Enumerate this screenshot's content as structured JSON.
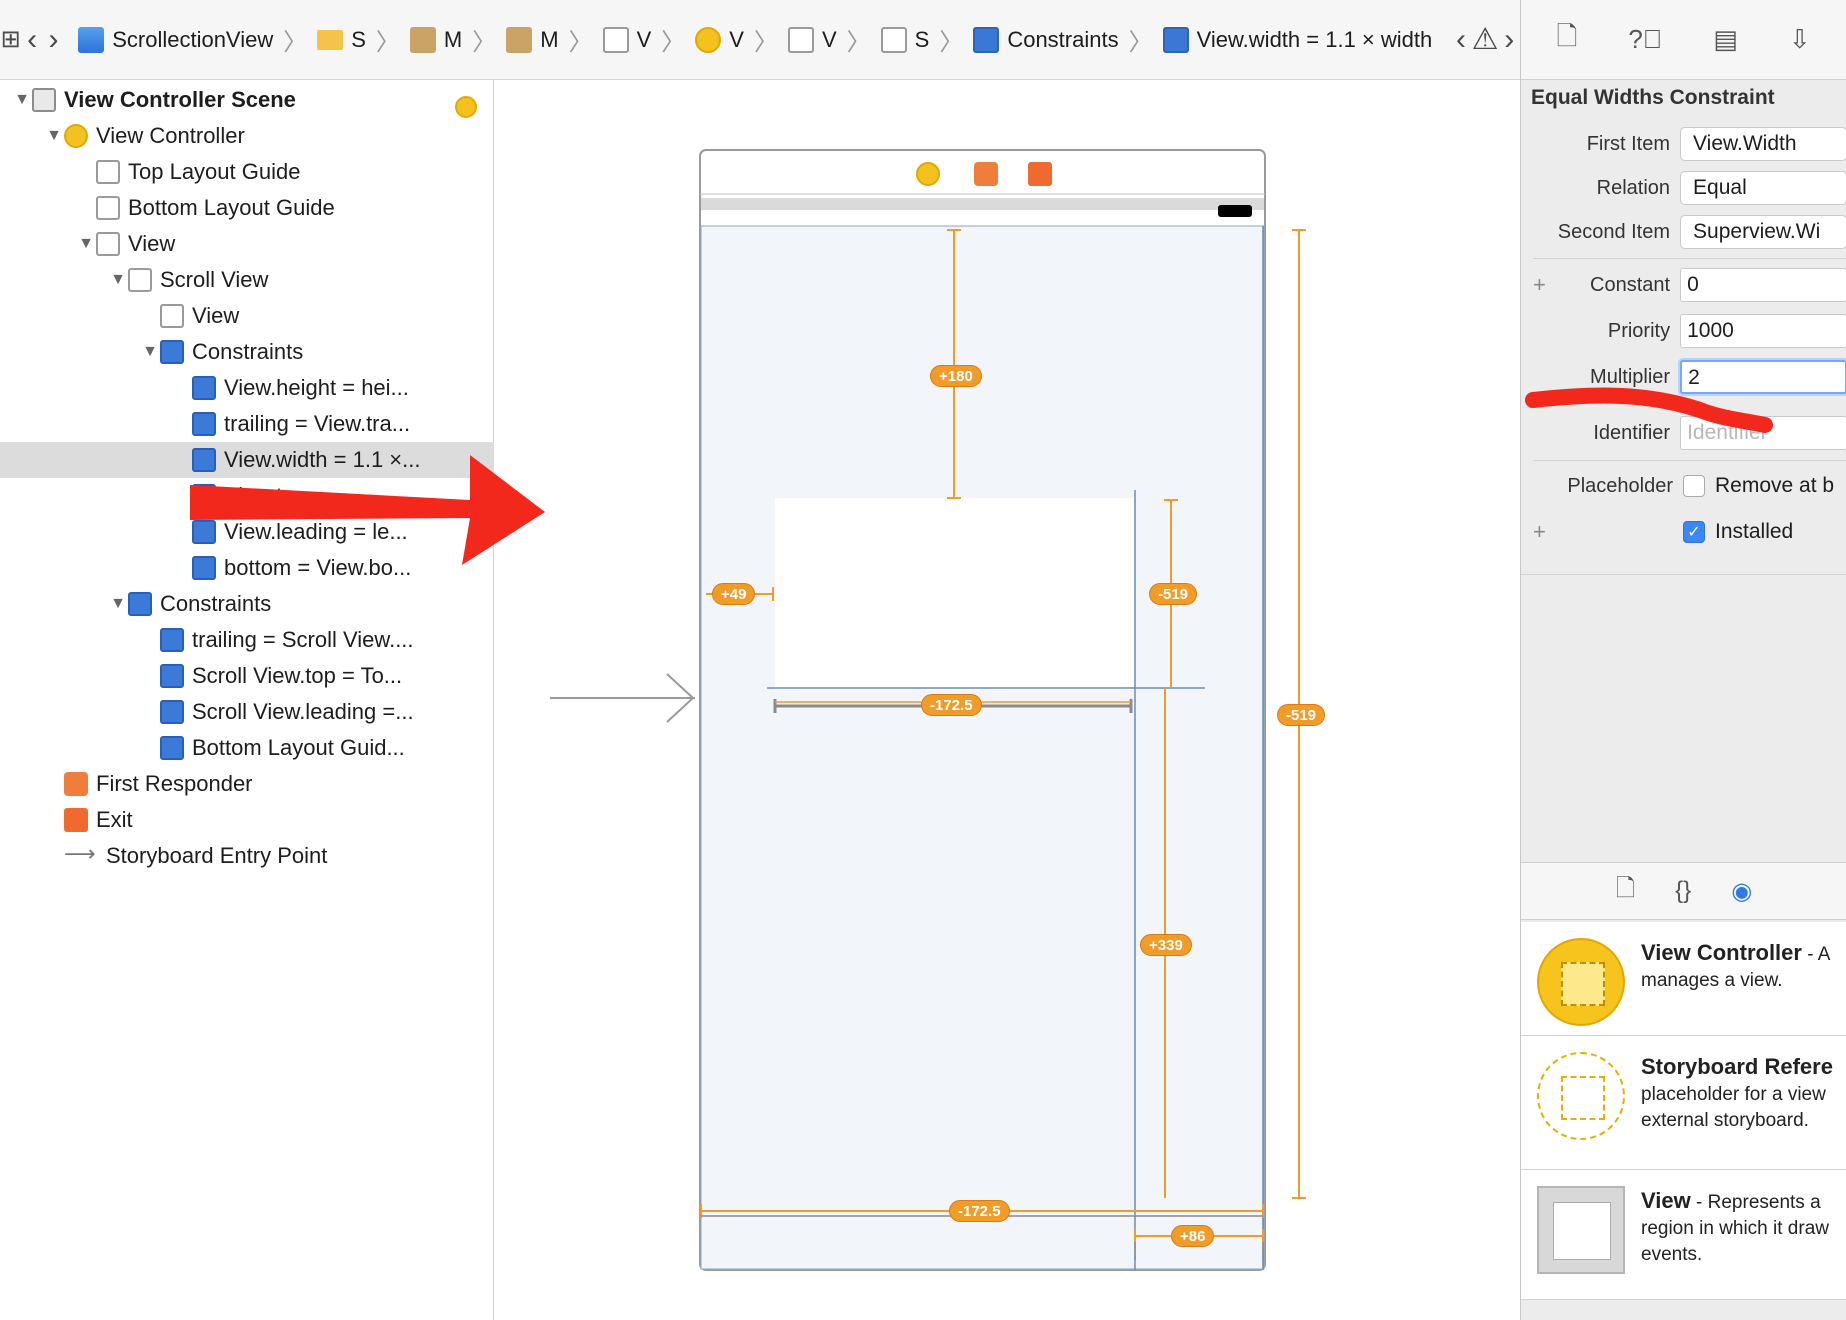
{
  "jumpbar": {
    "crumbs": [
      {
        "label": "ScrollectionView",
        "icon": "project-icon"
      },
      {
        "label": "S",
        "icon": "folder-icon"
      },
      {
        "label": "M",
        "icon": "storyboard-icon"
      },
      {
        "label": "M",
        "icon": "storyboard-icon"
      },
      {
        "label": "V",
        "icon": "scene-icon"
      },
      {
        "label": "V",
        "icon": "view-controller-icon"
      },
      {
        "label": "V",
        "icon": "view-icon"
      },
      {
        "label": "S",
        "icon": "scroll-view-icon"
      },
      {
        "label": "Constraints",
        "icon": "constraints-icon"
      },
      {
        "label": "View.width = 1.1 × width",
        "icon": "constraint-icon"
      }
    ]
  },
  "outline": {
    "items": [
      {
        "label": "View Controller Scene",
        "depth": 0,
        "disclosure": "open",
        "icon": "scene"
      },
      {
        "label": "View Controller",
        "depth": 1,
        "disclosure": "open",
        "icon": "vc"
      },
      {
        "label": "Top Layout Guide",
        "depth": 2,
        "disclosure": "none",
        "icon": "view"
      },
      {
        "label": "Bottom Layout Guide",
        "depth": 2,
        "disclosure": "none",
        "icon": "view"
      },
      {
        "label": "View",
        "depth": 2,
        "disclosure": "open",
        "icon": "view"
      },
      {
        "label": "Scroll View",
        "depth": 3,
        "disclosure": "open",
        "icon": "view"
      },
      {
        "label": "View",
        "depth": 4,
        "disclosure": "none",
        "icon": "view"
      },
      {
        "label": "Constraints",
        "depth": 4,
        "disclosure": "open",
        "icon": "cons"
      },
      {
        "label": "View.height = hei...",
        "depth": 5,
        "disclosure": "none",
        "icon": "cons"
      },
      {
        "label": "trailing = View.tra...",
        "depth": 5,
        "disclosure": "none",
        "icon": "cons"
      },
      {
        "label": "View.width = 1.1 ×...",
        "depth": 5,
        "disclosure": "none",
        "icon": "cons",
        "selected": true
      },
      {
        "label": "View.top",
        "depth": 5,
        "disclosure": "none",
        "icon": "cons"
      },
      {
        "label": "View.leading = le...",
        "depth": 5,
        "disclosure": "none",
        "icon": "cons"
      },
      {
        "label": "bottom = View.bo...",
        "depth": 5,
        "disclosure": "none",
        "icon": "cons"
      },
      {
        "label": "Constraints",
        "depth": 3,
        "disclosure": "open",
        "icon": "cons"
      },
      {
        "label": "trailing = Scroll View....",
        "depth": 4,
        "disclosure": "none",
        "icon": "cons"
      },
      {
        "label": "Scroll View.top = To...",
        "depth": 4,
        "disclosure": "none",
        "icon": "cons"
      },
      {
        "label": "Scroll View.leading =...",
        "depth": 4,
        "disclosure": "none",
        "icon": "cons"
      },
      {
        "label": "Bottom Layout Guid...",
        "depth": 4,
        "disclosure": "none",
        "icon": "cons"
      },
      {
        "label": "First Responder",
        "depth": 1,
        "disclosure": "none",
        "icon": "fr"
      },
      {
        "label": "Exit",
        "depth": 1,
        "disclosure": "none",
        "icon": "exit"
      },
      {
        "label": "Storyboard Entry Point",
        "depth": 1,
        "disclosure": "none",
        "icon": "entry"
      }
    ]
  },
  "canvas": {
    "badges": [
      "+180",
      "+49",
      "-519",
      "-172.5",
      "-519",
      "+339",
      "-172.5",
      "+86"
    ]
  },
  "inspector": {
    "title": "Equal Widths Constraint",
    "first_item_label": "First Item",
    "first_item_value": "View.Width",
    "relation_label": "Relation",
    "relation_value": "Equal",
    "second_item_label": "Second Item",
    "second_item_value": "Superview.Wi",
    "constant_label": "Constant",
    "constant_value": "0",
    "priority_label": "Priority",
    "priority_value": "1000",
    "multiplier_label": "Multiplier",
    "multiplier_value": "2",
    "identifier_label": "Identifier",
    "identifier_placeholder": "Identifier",
    "placeholder_label": "Placeholder",
    "placeholder_checkbox_label": "Remove at b",
    "installed_label": "Installed"
  },
  "library": {
    "items": [
      {
        "title": "View Controller",
        "rest": " - A",
        "desc": [
          "manages a view."
        ]
      },
      {
        "title": "Storyboard Refere",
        "rest": "",
        "desc": [
          "placeholder for a view",
          "external storyboard."
        ]
      },
      {
        "title": "View",
        "rest": " - Represents a",
        "desc": [
          "region in which it draw",
          "events."
        ]
      }
    ]
  },
  "colors": {
    "constraint_orange": "#f19b29",
    "annotation_red": "#f3281c",
    "selection_gray": "#dcdcdc",
    "accent_blue": "#3b87f5"
  }
}
